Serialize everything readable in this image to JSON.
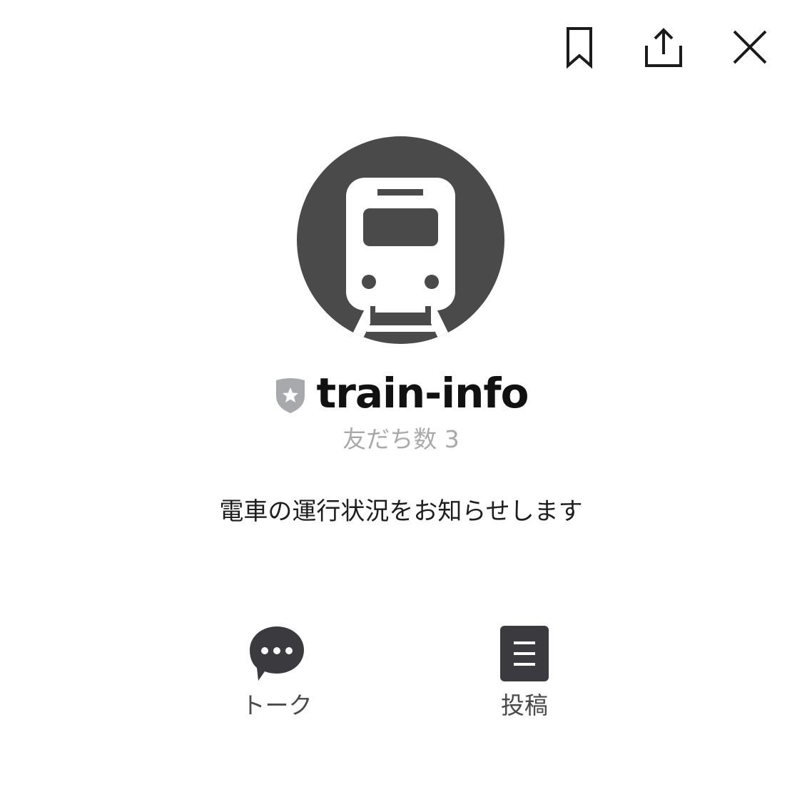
{
  "header": {
    "icons": [
      "bookmark-icon",
      "share-icon",
      "close-icon"
    ]
  },
  "profile": {
    "avatar_icon": "train-icon",
    "badge_icon": "verified-shield-icon",
    "name": "train-info",
    "friends_label": "友だち数 3",
    "description": "電車の運行状況をお知らせします"
  },
  "actions": [
    {
      "label": "トーク",
      "icon": "chat-bubble-icon"
    },
    {
      "label": "投稿",
      "icon": "posts-icon"
    }
  ],
  "colors": {
    "avatar_bg": "#4a4a4b",
    "icon_dark": "#3b3b3f",
    "badge_gray": "#a7a9ac",
    "muted_text": "#a9a9a9"
  }
}
